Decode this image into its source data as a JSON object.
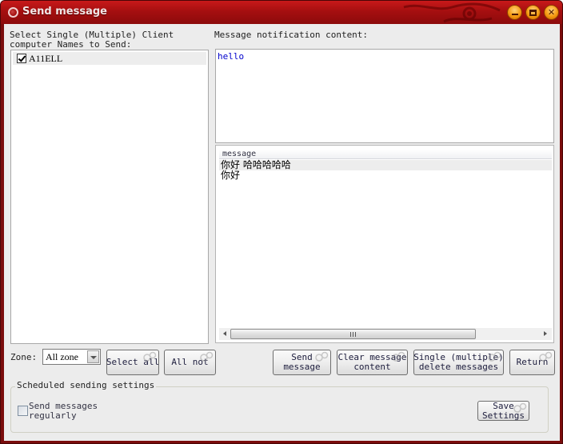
{
  "window": {
    "title": "Send message",
    "controls": {
      "minimize": "minimize",
      "maximize": "maximize",
      "close": "close"
    }
  },
  "clients": {
    "label": "Select Single (Multiple) Client computer Names to Send:",
    "items": [
      {
        "name": "A11ELL",
        "checked": true
      }
    ]
  },
  "message_content": {
    "label": "Message notification content:",
    "value": "hello"
  },
  "message_list": {
    "column_header": "message",
    "rows": [
      "你好 哈哈哈哈哈",
      "你好"
    ],
    "scrollbar_grip": "III"
  },
  "zone": {
    "label": "Zone:",
    "selected": "All zone"
  },
  "buttons": {
    "select_all": "Select all",
    "all_not": "All not",
    "send_message": "Send\nmessage",
    "clear_content": "Clear message\ncontent",
    "delete_messages": "Single (multiple)\ndelete messages",
    "return": "Return",
    "save_settings": "Save\nSettings"
  },
  "scheduled": {
    "group_title": "Scheduled sending settings",
    "regular_label": "Send messages regularly",
    "regular_checked": false
  },
  "colors": {
    "titlebar": "#a50f10",
    "window_bg": "#ececec",
    "content_text": "#0000cc",
    "window_button": "#f59a10"
  }
}
